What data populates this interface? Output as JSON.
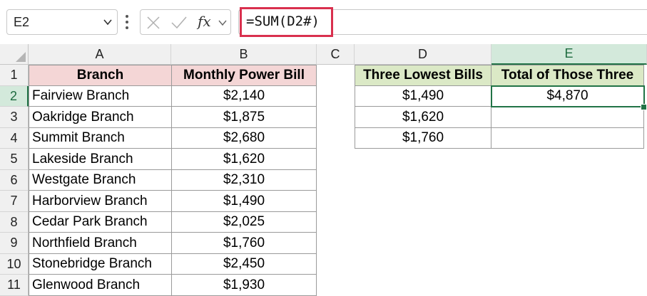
{
  "name_box": {
    "value": "E2"
  },
  "formula_bar": {
    "formula": "=SUM(D2#)",
    "fx_label": "fx"
  },
  "columns": [
    "A",
    "B",
    "C",
    "D",
    "E"
  ],
  "rows": [
    "1",
    "2",
    "3",
    "4",
    "5",
    "6",
    "7",
    "8",
    "9",
    "10",
    "11"
  ],
  "selected": {
    "column": "E",
    "row": "2"
  },
  "table1": {
    "headers": [
      "Branch",
      "Monthly Power Bill"
    ],
    "rows": [
      [
        "Fairview Branch",
        "$2,140"
      ],
      [
        "Oakridge Branch",
        "$1,875"
      ],
      [
        "Summit Branch",
        "$2,680"
      ],
      [
        "Lakeside Branch",
        "$1,620"
      ],
      [
        "Westgate Branch",
        "$2,310"
      ],
      [
        "Harborview Branch",
        "$1,490"
      ],
      [
        "Cedar Park Branch",
        "$2,025"
      ],
      [
        "Northfield Branch",
        "$1,760"
      ],
      [
        "Stonebridge Branch",
        "$2,450"
      ],
      [
        "Glenwood Branch",
        "$1,930"
      ]
    ]
  },
  "table2": {
    "headers": [
      "Three Lowest Bills",
      "Total of Those Three"
    ],
    "rows": [
      [
        "$1,490",
        "$4,870"
      ],
      [
        "$1,620",
        ""
      ],
      [
        "$1,760",
        ""
      ]
    ]
  },
  "colors": {
    "accent_green": "#217346",
    "formula_highlight": "#d9304e",
    "header_pink": "#f4d6d6",
    "header_green": "#dbe9c6"
  }
}
